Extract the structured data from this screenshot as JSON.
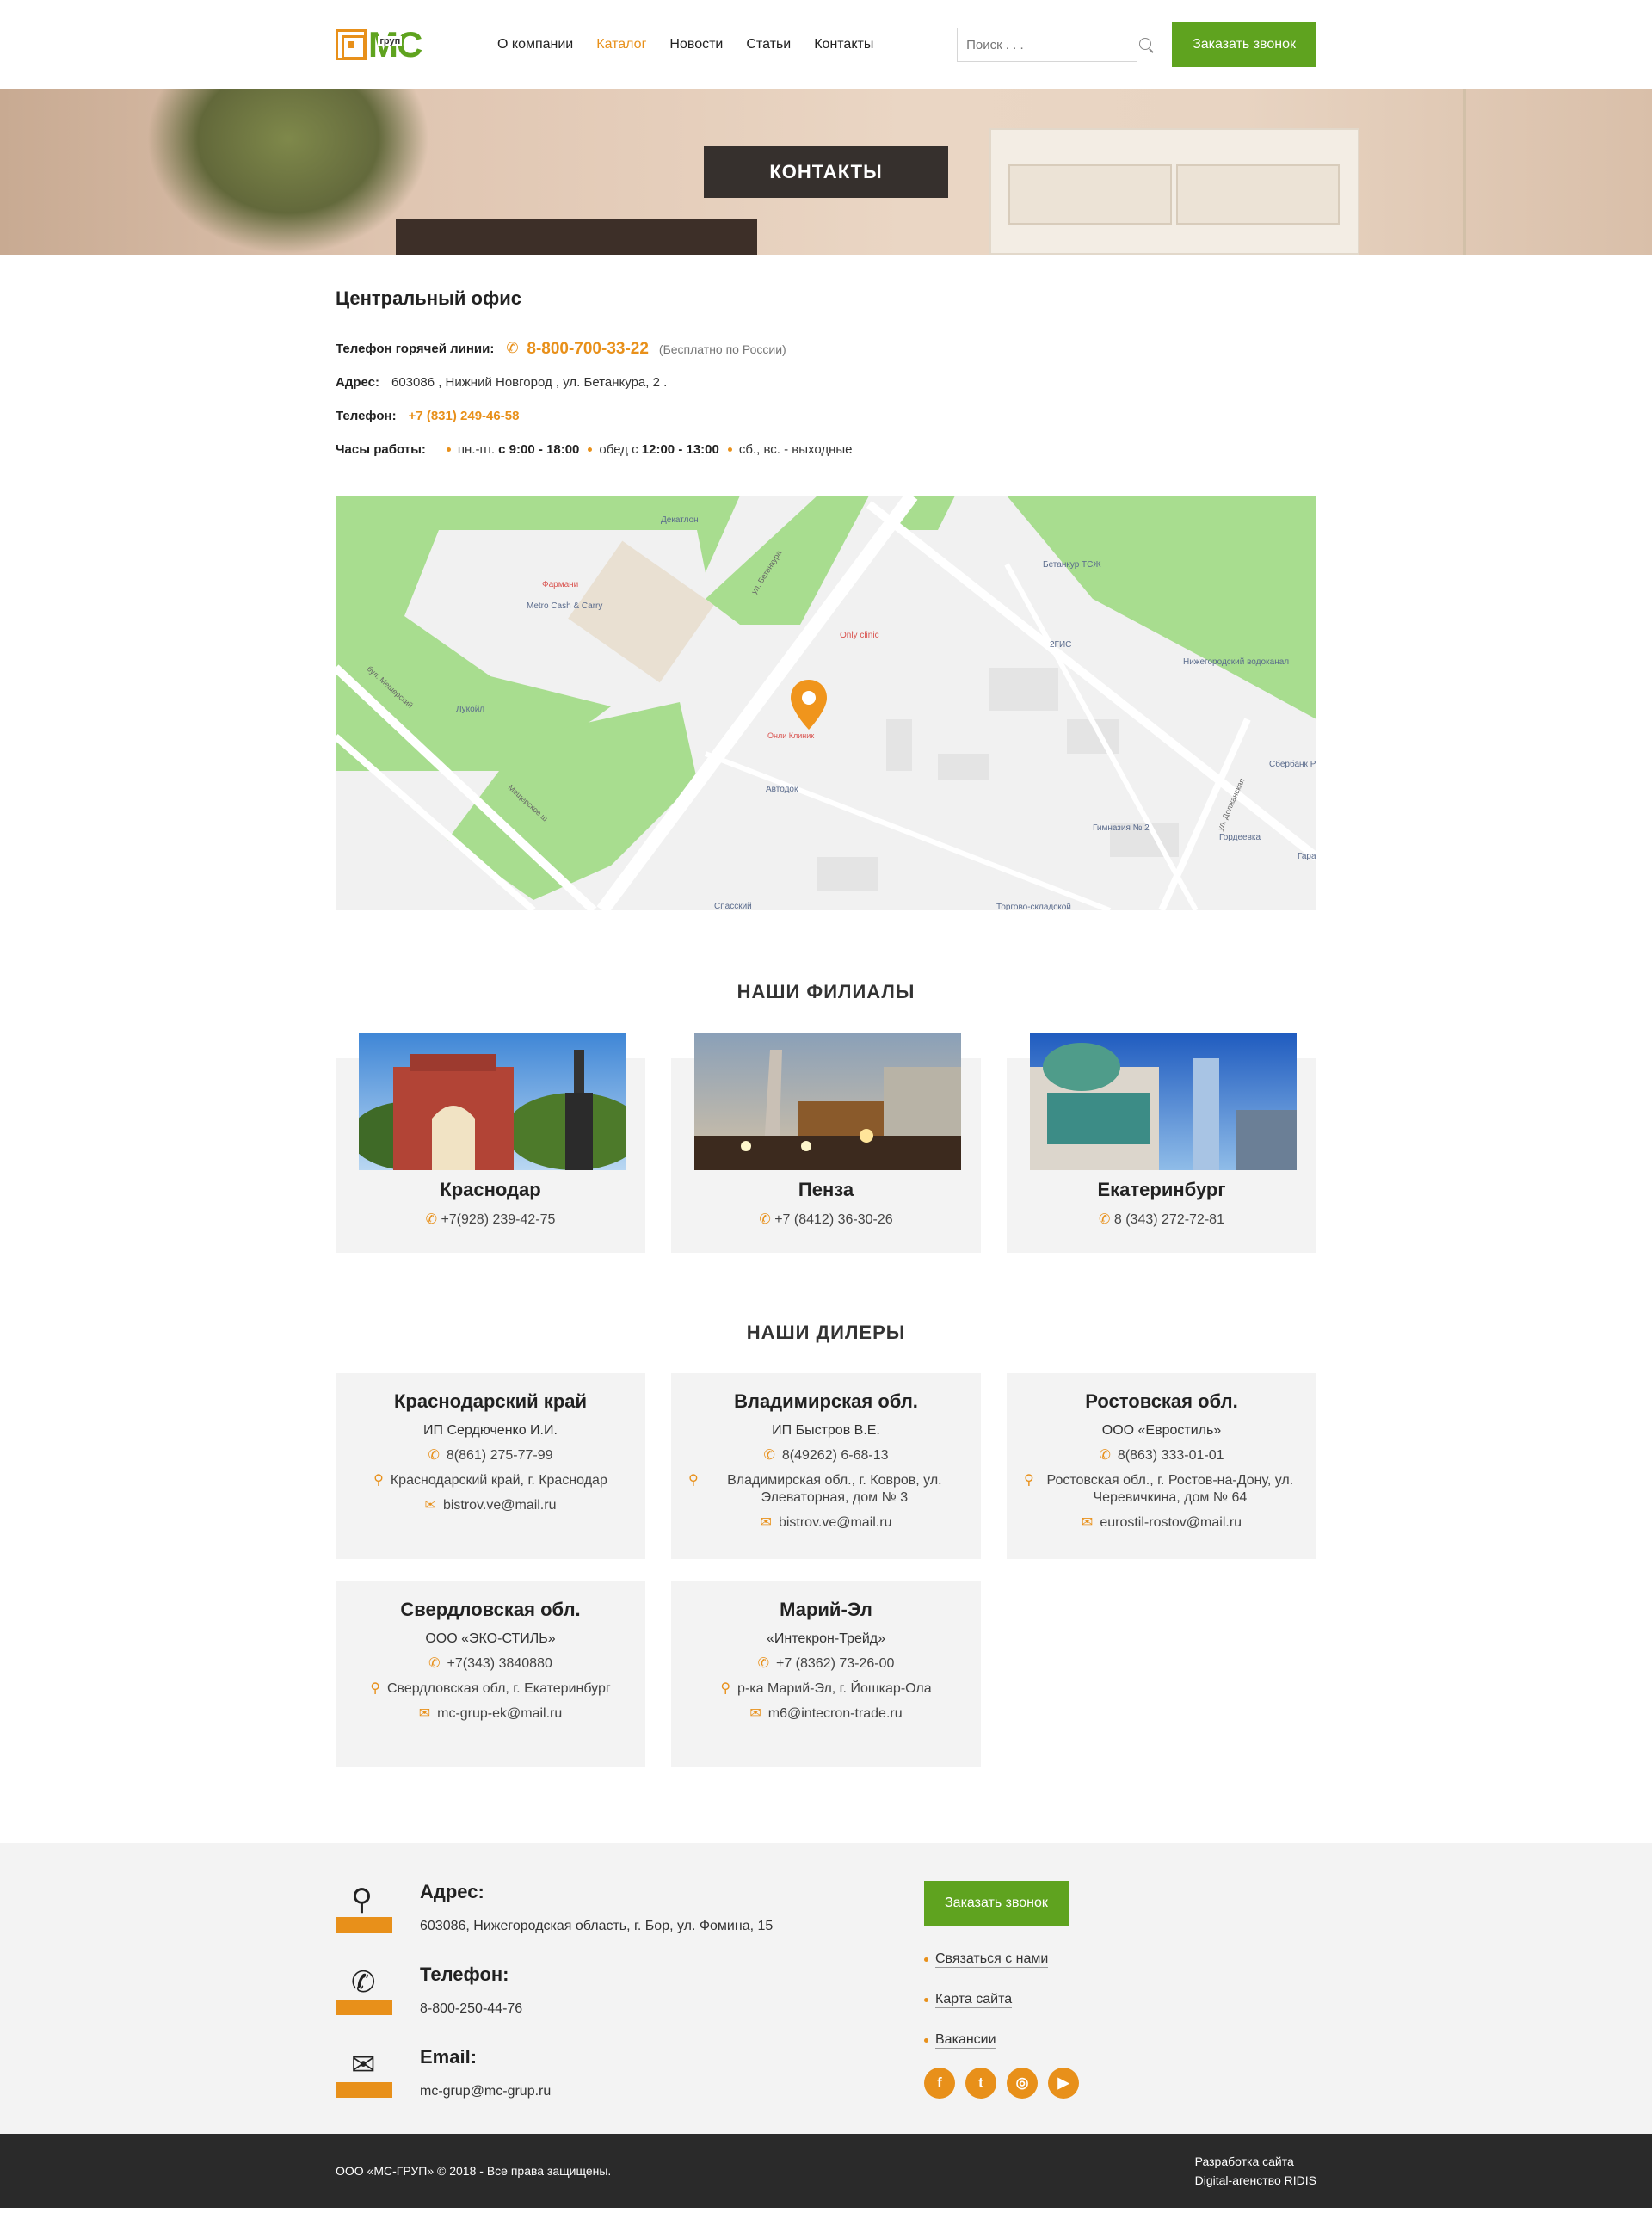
{
  "header": {
    "logo_text": "МС",
    "logo_sub": "груп",
    "nav": [
      "О компании",
      "Каталог",
      "Новости",
      "Статьи",
      "Контакты"
    ],
    "search_placeholder": "Поиск . . .",
    "callback_button": "Заказать звонок"
  },
  "hero": {
    "title": "КОНТАКТЫ"
  },
  "office": {
    "title": "Центральный офис",
    "hotline_label": "Телефон горячей линии:",
    "hotline_number": "8-800-700-33-22",
    "hotline_note": "(Бесплатно по России)",
    "address_label": "Адрес:",
    "address_value": "603086 ,  Нижний Новгород ,  ул. Бетанкура, 2 .",
    "phone_label": "Телефон:",
    "phone_value": "+7 (831) 249-46-58",
    "hours_label": "Часы работы:",
    "hours": [
      {
        "pre": "пн.-пт.",
        "bold": "с 9:00 - 18:00",
        "post": ""
      },
      {
        "pre": "обед с",
        "bold": "12:00 - 13:00",
        "post": ""
      },
      {
        "pre": "сб., вс. - выходные",
        "bold": "",
        "post": ""
      }
    ]
  },
  "map": {
    "labels": [
      "Декатлон",
      "Фармани",
      "Metro Cash & Carry",
      "Лукойл",
      "Only clinic",
      "Онли Клиник",
      "Автодок",
      "Бетанкур ТСЖ",
      "2ГИС",
      "Нижегородский водоканал",
      "Сбербанк Р",
      "Гимназия № 2",
      "Гордеевка",
      "Гараж",
      "Спасский",
      "Торгово-складской",
      "ул. Бетанкура",
      "бул. Мещерский",
      "ул. Должанская",
      "Мещерское ш."
    ]
  },
  "branches_title": "НАШИ ФИЛИАЛЫ",
  "branches": [
    {
      "city": "Краснодар",
      "phone": "+7(928) 239-42-75"
    },
    {
      "city": "Пенза",
      "phone": "+7 (8412) 36-30-26"
    },
    {
      "city": "Екатеринбург",
      "phone": "8 (343) 272-72-81"
    }
  ],
  "dealers_title": "НАШИ ДИЛЕРЫ",
  "dealers": [
    {
      "region": "Краснодарский край",
      "org": "ИП Сердюченко И.И.",
      "phone": "8(861) 275-77-99",
      "address": "Краснодарский край, г. Краснодар",
      "email": "bistrov.ve@mail.ru"
    },
    {
      "region": "Владимирская обл.",
      "org": "ИП Быстров В.Е.",
      "phone": "8(49262) 6-68-13",
      "address": "Владимирская обл., г. Ковров, ул. Элеваторная, дом № 3",
      "email": "bistrov.ve@mail.ru"
    },
    {
      "region": "Ростовская обл.",
      "org": "ООО «Евростиль»",
      "phone": "8(863) 333-01-01",
      "address": "Ростовская обл., г. Ростов-на-Дону, ул. Черевичкина, дом № 64",
      "email": "eurostil-rostov@mail.ru"
    },
    {
      "region": "Свердловская обл.",
      "org": "ООО «ЭКО-СТИЛЬ»",
      "phone": "+7(343) 3840880",
      "address": "Свердловская обл, г. Екатеринбург",
      "email": "mc-grup-ek@mail.ru"
    },
    {
      "region": "Марий-Эл",
      "org": "«Интекрон-Трейд»",
      "phone": "+7 (8362) 73-26-00",
      "address": "р-ка Марий-Эл, г. Йошкар-Ола",
      "email": "m6@intecron-trade.ru"
    }
  ],
  "footer": {
    "address_label": "Адрес:",
    "address_value": "603086, Нижегородская область, г. Бор, ул. Фомина, 15",
    "phone_label": "Телефон:",
    "phone_value": "8-800-250-44-76",
    "email_label": "Email:",
    "email_value": "mc-grup@mc-grup.ru",
    "callback_button": "Заказать звонок",
    "links": [
      "Связаться с нами",
      "Карта сайта",
      "Вакансии"
    ],
    "social": [
      "facebook-icon",
      "twitter-icon",
      "instagram-icon",
      "youtube-icon"
    ],
    "copyright": "ООО «МС-ГРУП» © 2018 - Все права защищены.",
    "dev_line1": "Разработка сайта",
    "dev_line2": "Digital-агенство RIDIS"
  }
}
